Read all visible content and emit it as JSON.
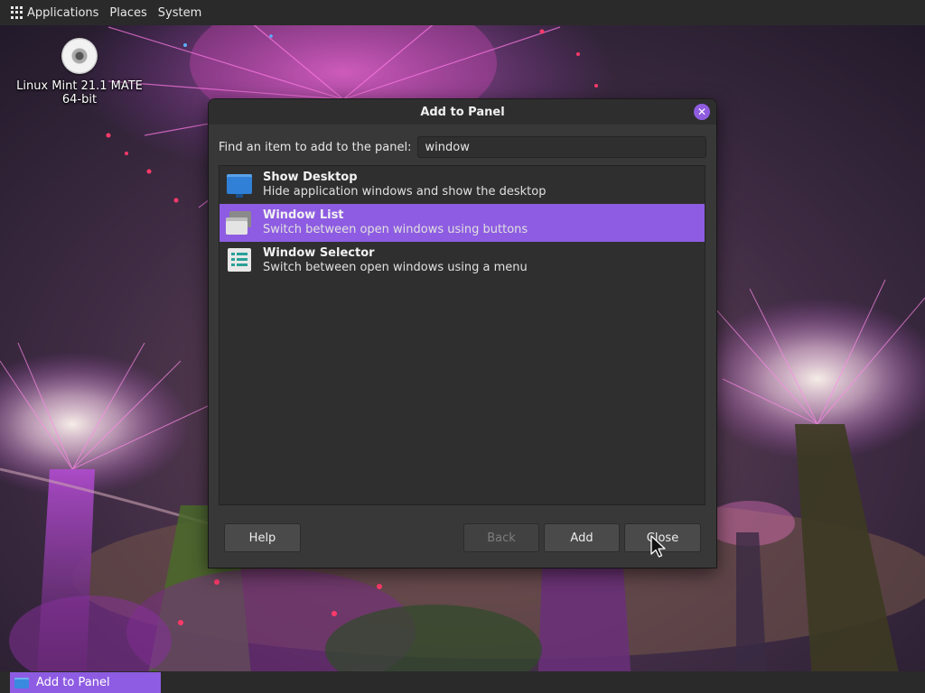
{
  "top_panel": {
    "applications": "Applications",
    "places": "Places",
    "system": "System"
  },
  "desktop": {
    "icon_label_line1": "Linux Mint 21.1 MATE",
    "icon_label_line2": "64-bit",
    "icon": "cd-disc-icon"
  },
  "dialog": {
    "title": "Add to Panel",
    "close_icon": "close-icon",
    "find_label": "Find an item to add to the panel:",
    "search_value": "window",
    "items": [
      {
        "title": "Show Desktop",
        "description": "Hide application windows and show the desktop",
        "icon": "show-desktop-icon",
        "selected": false
      },
      {
        "title": "Window List",
        "description": "Switch between open windows using buttons",
        "icon": "window-list-icon",
        "selected": true
      },
      {
        "title": "Window Selector",
        "description": "Switch between open windows using a menu",
        "icon": "window-selector-icon",
        "selected": false
      }
    ],
    "buttons": {
      "help": "Help",
      "back": "Back",
      "add": "Add",
      "close": "Close"
    },
    "accent_color": "#8e5ce2"
  },
  "taskbar": {
    "items": [
      {
        "label": "Add to Panel",
        "active": true
      }
    ]
  }
}
